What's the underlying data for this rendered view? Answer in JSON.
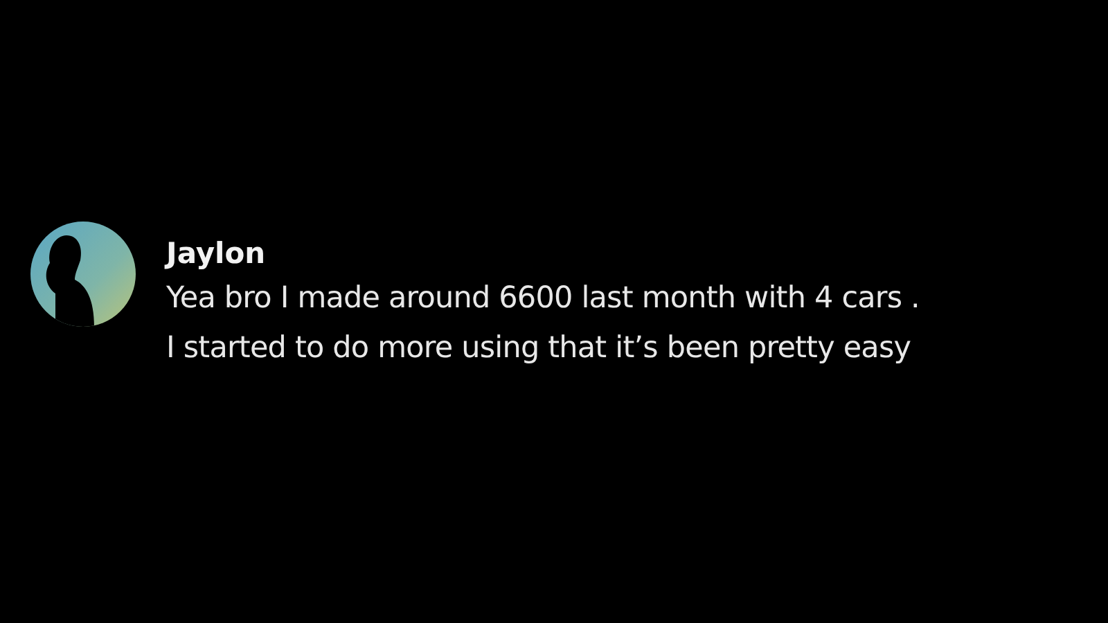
{
  "message": {
    "author": "Jaylon",
    "lines": [
      "Yea bro I made around 6600 last month with 4 cars .",
      "I started to do more using that it’s been pretty easy"
    ]
  }
}
